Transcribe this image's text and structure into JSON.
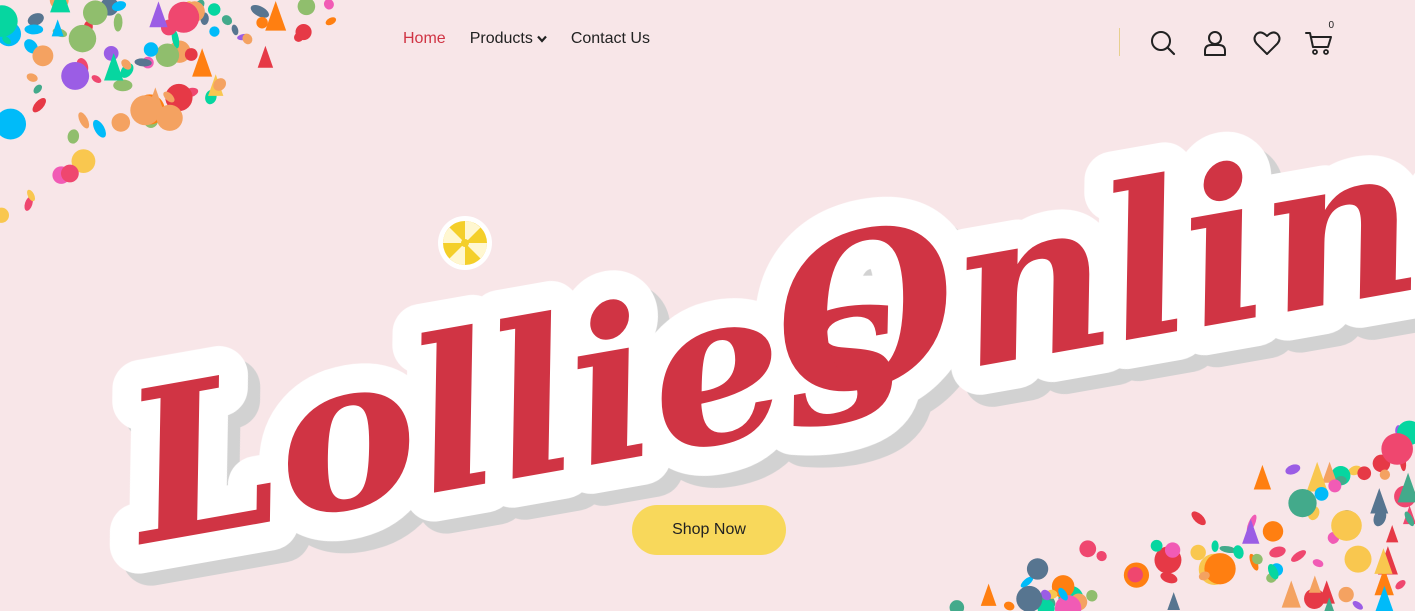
{
  "nav": {
    "home": "Home",
    "products": "Products",
    "contact": "Contact Us"
  },
  "header_icons": {
    "search": "search-icon",
    "account": "user-icon",
    "wishlist": "heart-icon",
    "cart": "cart-icon",
    "cart_count": "0"
  },
  "hero": {
    "title_word1": "Lollies",
    "title_word2": "Online",
    "cta": "Shop Now"
  },
  "colors": {
    "background": "#f8e6e8",
    "brand_red": "#d03444",
    "cta_yellow": "#f8d85b",
    "active_nav": "#d03444"
  }
}
